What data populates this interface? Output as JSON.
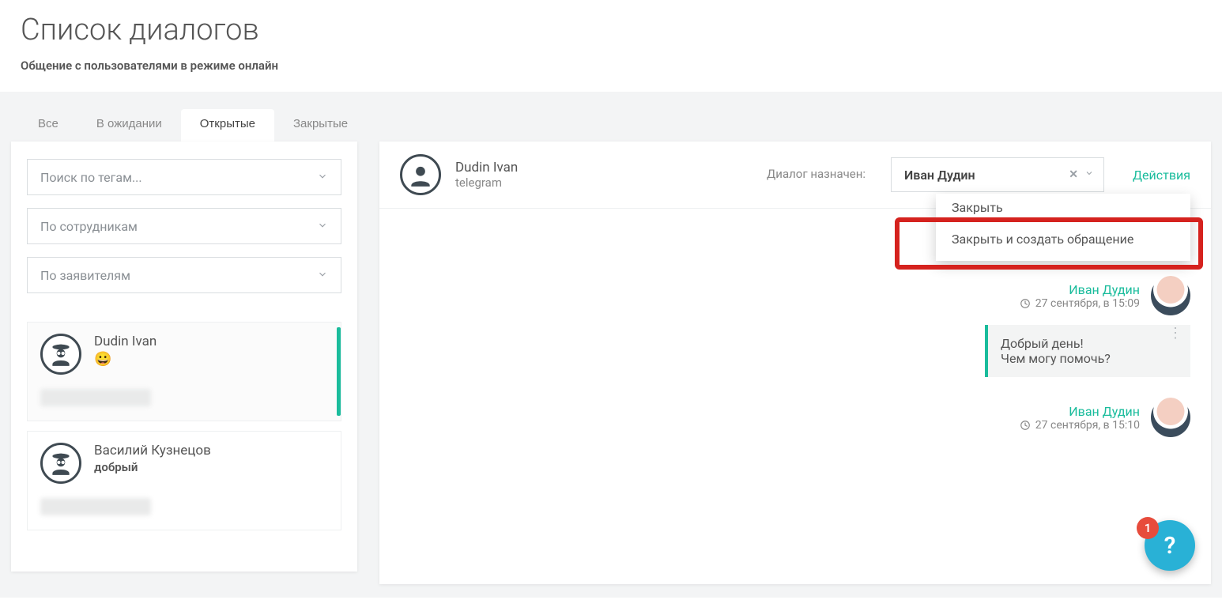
{
  "header": {
    "title": "Список диалогов",
    "subtitle": "Общение с пользователями в режиме онлайн"
  },
  "tabs": [
    {
      "label": "Все"
    },
    {
      "label": "В ожидании"
    },
    {
      "label": "Открытые"
    },
    {
      "label": "Закрытые"
    }
  ],
  "active_tab_index": 2,
  "filters": {
    "tags": "Поиск по тегам...",
    "staff": "По сотрудникам",
    "applicants": "По заявителям"
  },
  "dialogs": [
    {
      "name": "Dudin Ivan",
      "preview": "😀",
      "preview_is_emoji": true,
      "active": true
    },
    {
      "name": "Василий Кузнецов",
      "preview": "добрый",
      "preview_is_emoji": false,
      "active": false
    }
  ],
  "chat": {
    "contact_name": "Dudin Ivan",
    "contact_source": "telegram",
    "assigned_label": "Диалог назначен:",
    "assignee": "Иван Дудин",
    "actions_label": "Действия",
    "dropdown": [
      "Закрыть",
      "Закрыть и создать обращение"
    ],
    "messages": [
      {
        "author": "Иван Дудин",
        "time": "27 сентября, в 15:09",
        "lines": [
          "Добрый день!",
          "Чем могу помочь?"
        ]
      },
      {
        "author": "Иван Дудин",
        "time": "27 сентября, в 15:10",
        "lines": []
      }
    ]
  },
  "fab": {
    "label": "?",
    "badge": "1"
  },
  "colors": {
    "accent": "#1abc9c",
    "highlight": "#d5221e",
    "fab": "#29b1d6"
  }
}
